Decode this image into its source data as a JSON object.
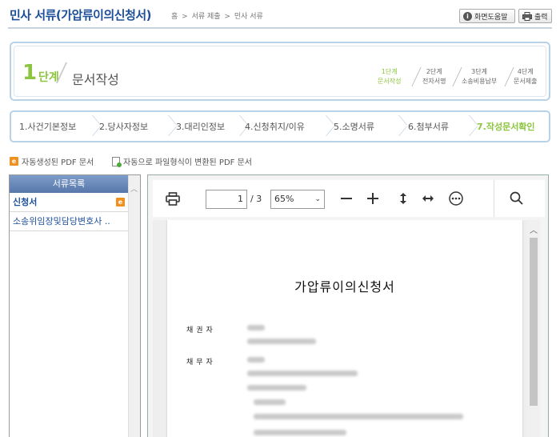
{
  "header": {
    "title": "민사 서류(가압류이의신청서)",
    "breadcrumb": [
      "홈",
      ">",
      "서류 제출",
      ">",
      "민사 서류"
    ],
    "help_label": "화면도움말",
    "print_label": "출력"
  },
  "step": {
    "number": "1",
    "unit": "단계",
    "title": "문서작성",
    "mini_steps": [
      {
        "line1": "1단계",
        "line2": "문서작성"
      },
      {
        "line1": "2단계",
        "line2": "전자서명"
      },
      {
        "line1": "3단계",
        "line2": "소송비용납부"
      },
      {
        "line1": "4단계",
        "line2": "문서제출"
      }
    ]
  },
  "tabs": [
    "1.사건기본정보",
    "2.당사자정보",
    "3.대리인정보",
    "4.신청취지/이유",
    "5.소명서류",
    "6.첨부서류",
    "7.작성문서확인"
  ],
  "legend": {
    "auto_pdf": "자동생성된 PDF 문서",
    "converted_pdf": "자동으로 파일형식이 변환된 PDF 문서"
  },
  "doc_list": {
    "header": "서류목록",
    "items": [
      "신청서",
      "소송위임장및담당변호사 .."
    ]
  },
  "viewer": {
    "page_current": "1",
    "page_total": "/ 3",
    "zoom": "65%",
    "doc_title": "가압류이의신청서",
    "field_creditor": "채권자",
    "field_debtor": "채무자"
  }
}
